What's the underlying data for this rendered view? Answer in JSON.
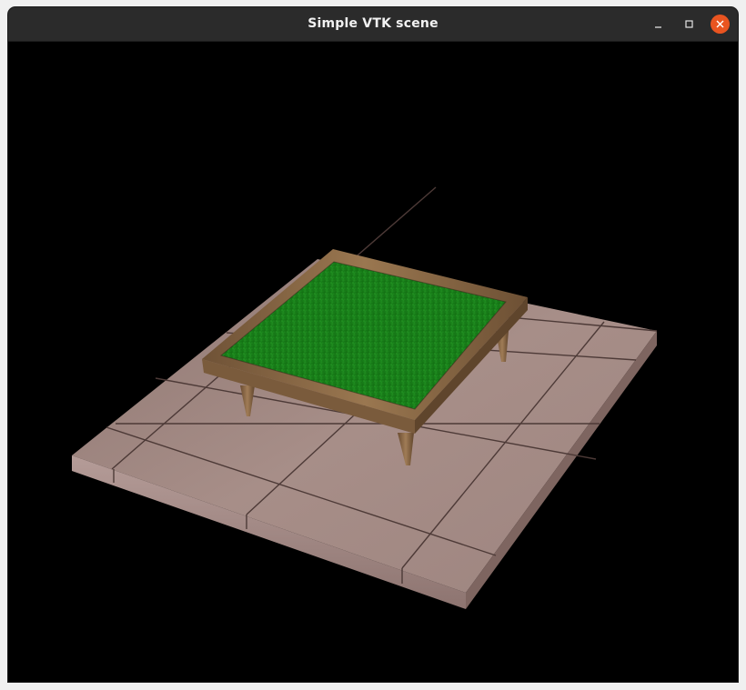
{
  "window": {
    "title": "Simple VTK scene"
  },
  "controls": {
    "minimize_icon": "minimize-icon",
    "maximize_icon": "maximize-icon",
    "close_icon": "close-icon",
    "close_color": "#e95420"
  },
  "scene": {
    "background_color": "#000000",
    "objects": [
      {
        "name": "tiled-floor",
        "material": "marble tiles",
        "color": "#a48a84"
      },
      {
        "name": "raised-bed-frame",
        "material": "wood",
        "color": "#8a6a45"
      },
      {
        "name": "grass-surface",
        "material": "grass",
        "color": "#1f8f20"
      }
    ]
  }
}
